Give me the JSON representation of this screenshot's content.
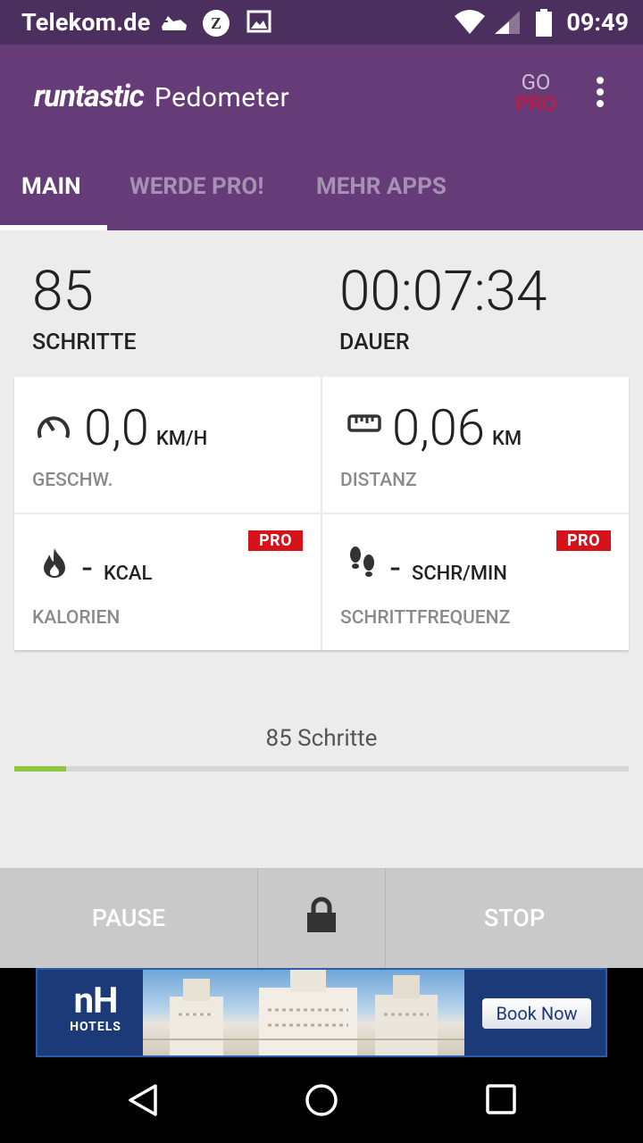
{
  "status_bar": {
    "carrier": "Telekom.de",
    "time": "09:49",
    "icons": [
      "shoe-icon",
      "zalando-icon",
      "image-icon",
      "wifi-icon",
      "signal-icon",
      "battery-icon"
    ]
  },
  "app_bar": {
    "logo": "runtastic",
    "app_name": "Pedometer",
    "go_label": "GO",
    "pro_label": "PRO",
    "accent_color": "#653c77",
    "pro_color": "#d6143a"
  },
  "tabs": [
    {
      "label": "MAIN",
      "active": true
    },
    {
      "label": "WERDE PRO!",
      "active": false
    },
    {
      "label": "MEHR APPS",
      "active": false
    }
  ],
  "summary": {
    "steps_value": "85",
    "steps_label": "SCHRITTE",
    "duration_value": "00:07:34",
    "duration_label": "DAUER"
  },
  "metrics": {
    "speed": {
      "value": "0,0",
      "unit": "KM/H",
      "label": "GESCHW.",
      "icon": "speedometer-icon"
    },
    "distance": {
      "value": "0,06",
      "unit": "KM",
      "label": "DISTANZ",
      "icon": "ruler-icon"
    },
    "calories": {
      "value": "-",
      "unit": "KCAL",
      "label": "KALORIEN",
      "icon": "flame-icon",
      "badge": "PRO"
    },
    "cadence": {
      "value": "-",
      "unit": "SCHR/MIN",
      "label": "SCHRITTFREQUENZ",
      "icon": "footprints-icon",
      "badge": "PRO"
    }
  },
  "progress": {
    "label": "85 Schritte",
    "fraction": 0.085,
    "color": "#8dc63f"
  },
  "controls": {
    "pause_label": "PAUSE",
    "lock_icon": "lock-icon",
    "stop_label": "STOP"
  },
  "ad": {
    "brand_line1": "nH",
    "brand_line2": "HOTELS",
    "cta": "Book Now"
  },
  "nav_bar": {
    "icons": [
      "back-icon",
      "home-icon",
      "recents-icon"
    ]
  }
}
